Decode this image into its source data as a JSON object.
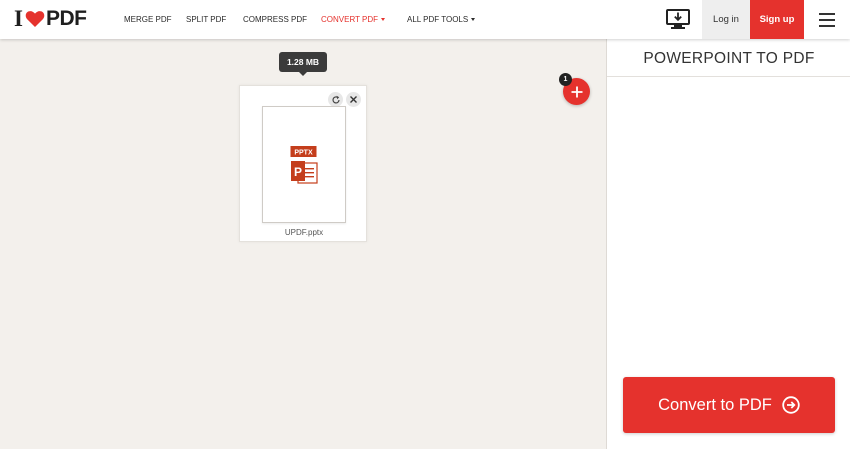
{
  "brand": {
    "logo_prefix": "I",
    "logo_suffix": "PDF",
    "accent_color": "#e5322d"
  },
  "nav": {
    "items": [
      {
        "label": "MERGE PDF"
      },
      {
        "label": "SPLIT PDF"
      },
      {
        "label": "COMPRESS PDF"
      },
      {
        "label": "CONVERT PDF"
      },
      {
        "label": "ALL PDF TOOLS"
      }
    ],
    "active": "CONVERT PDF"
  },
  "header": {
    "desktop_icon": "desktop-download-icon",
    "login_label": "Log in",
    "signup_label": "Sign up",
    "menu_icon": "hamburger-menu-icon"
  },
  "workspace": {
    "file": {
      "size_tooltip": "1.28 MB",
      "type_badge": "PPTX",
      "name": "UPDF.pptx"
    },
    "add_badge_count": "1"
  },
  "sidebar": {
    "title": "POWERPOINT TO PDF",
    "convert_label": "Convert to PDF"
  }
}
